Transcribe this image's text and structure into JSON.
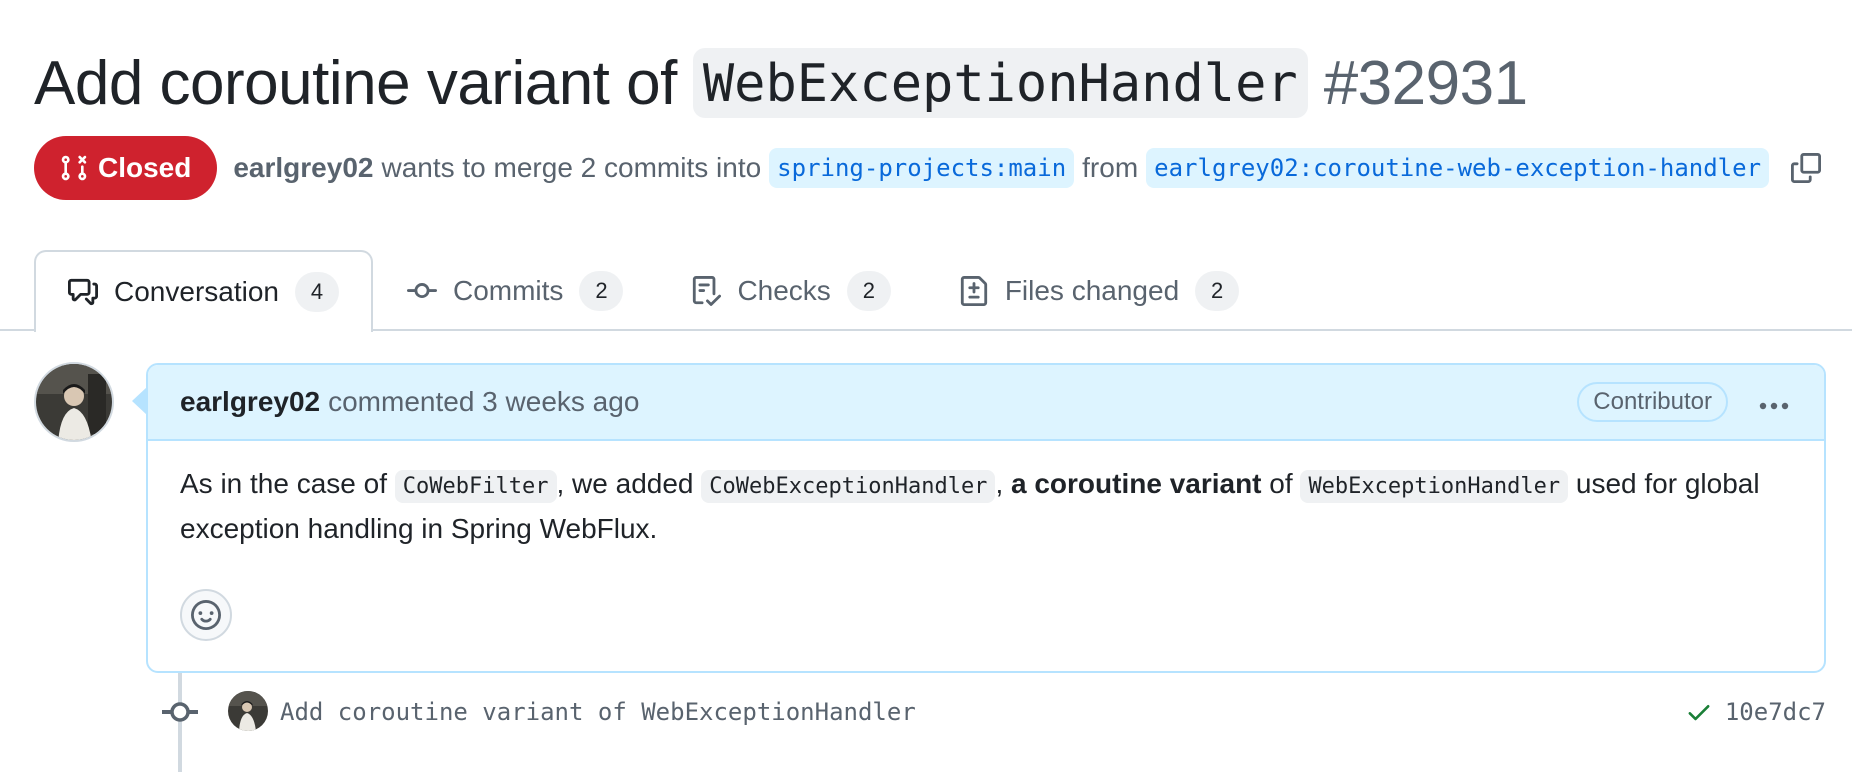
{
  "title": {
    "prefix": "Add coroutine variant of",
    "code": "WebExceptionHandler",
    "number": "#32931"
  },
  "meta": {
    "state": "Closed",
    "author": "earlgrey02",
    "merge_text": "wants to merge 2 commits into",
    "base_branch": "spring-projects:main",
    "from_text": "from",
    "head_branch": "earlgrey02:coroutine-web-exception-handler"
  },
  "tabs": [
    {
      "label": "Conversation",
      "count": "4",
      "icon": "comment-discussion-icon"
    },
    {
      "label": "Commits",
      "count": "2",
      "icon": "git-commit-icon"
    },
    {
      "label": "Checks",
      "count": "2",
      "icon": "checklist-icon"
    },
    {
      "label": "Files changed",
      "count": "2",
      "icon": "file-diff-icon"
    }
  ],
  "comment": {
    "author": "earlgrey02",
    "meta": "commented 3 weeks ago",
    "badge": "Contributor",
    "body": {
      "t1": "As in the case of ",
      "c1": "CoWebFilter",
      "t2": ", we added ",
      "c2": "CoWebExceptionHandler",
      "t3": ", ",
      "b1": "a coroutine variant",
      "t4": " of ",
      "c3": "WebExceptionHandler",
      "t5": " used for global exception handling in Spring WebFlux."
    }
  },
  "commit": {
    "message": "Add coroutine variant of WebExceptionHandler",
    "sha": "10e7dc7"
  },
  "colors": {
    "closed": "#cf222e",
    "link": "#0969da",
    "success": "#1a7f37",
    "header_bg": "#ddf4ff",
    "border_blue": "#b6e3ff"
  }
}
